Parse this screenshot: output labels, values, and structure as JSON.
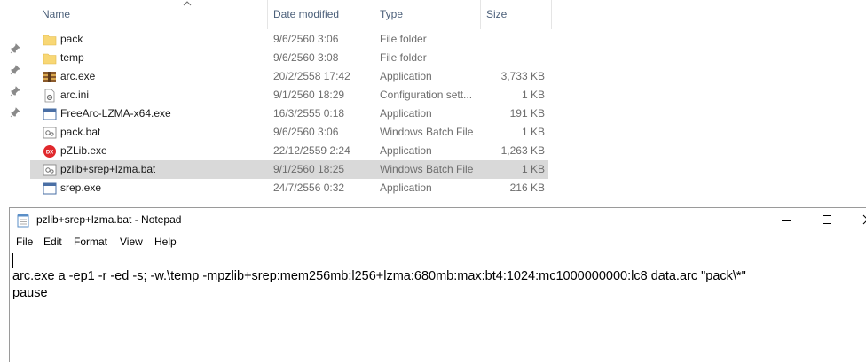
{
  "explorer": {
    "columns": {
      "name": "Name",
      "date": "Date modified",
      "type": "Type",
      "size": "Size"
    },
    "files": [
      {
        "name": "pack",
        "date": "9/6/2560 3:06",
        "type": "File folder",
        "size": "",
        "icon": "folder-icon"
      },
      {
        "name": "temp",
        "date": "9/6/2560 3:08",
        "type": "File folder",
        "size": "",
        "icon": "folder-icon"
      },
      {
        "name": "arc.exe",
        "date": "20/2/2558 17:42",
        "type": "Application",
        "size": "3,733 KB",
        "icon": "archive-app-icon"
      },
      {
        "name": "arc.ini",
        "date": "9/1/2560 18:29",
        "type": "Configuration sett...",
        "size": "1 KB",
        "icon": "config-file-icon"
      },
      {
        "name": "FreeArc-LZMA-x64.exe",
        "date": "16/3/2555 0:18",
        "type": "Application",
        "size": "191 KB",
        "icon": "application-icon"
      },
      {
        "name": "pack.bat",
        "date": "9/6/2560 3:06",
        "type": "Windows Batch File",
        "size": "1 KB",
        "icon": "batch-file-icon"
      },
      {
        "name": "pZLib.exe",
        "date": "22/12/2559 2:24",
        "type": "Application",
        "size": "1,263 KB",
        "icon": "pzlib-app-icon"
      },
      {
        "name": "pzlib+srep+lzma.bat",
        "date": "9/1/2560 18:25",
        "type": "Windows Batch File",
        "size": "1 KB",
        "icon": "batch-file-icon"
      },
      {
        "name": "srep.exe",
        "date": "24/7/2556 0:32",
        "type": "Application",
        "size": "216 KB",
        "icon": "application-icon"
      }
    ],
    "selected_index": 7
  },
  "notepad": {
    "title": "pzlib+srep+lzma.bat - Notepad",
    "menu": [
      "File",
      "Edit",
      "Format",
      "View",
      "Help"
    ],
    "lines": [
      "",
      "arc.exe a -ep1 -r -ed -s; -w.\\temp -mpzlib+srep:mem256mb:l256+lzma:680mb:max:bt4:1024:mc1000000000:lc8 data.arc \"pack\\*\"",
      "pause"
    ]
  },
  "colors": {
    "selection": "#d9d9d9",
    "header_text": "#4c607a",
    "folder": "#f8d775",
    "pzlib_red": "#e0282c"
  }
}
